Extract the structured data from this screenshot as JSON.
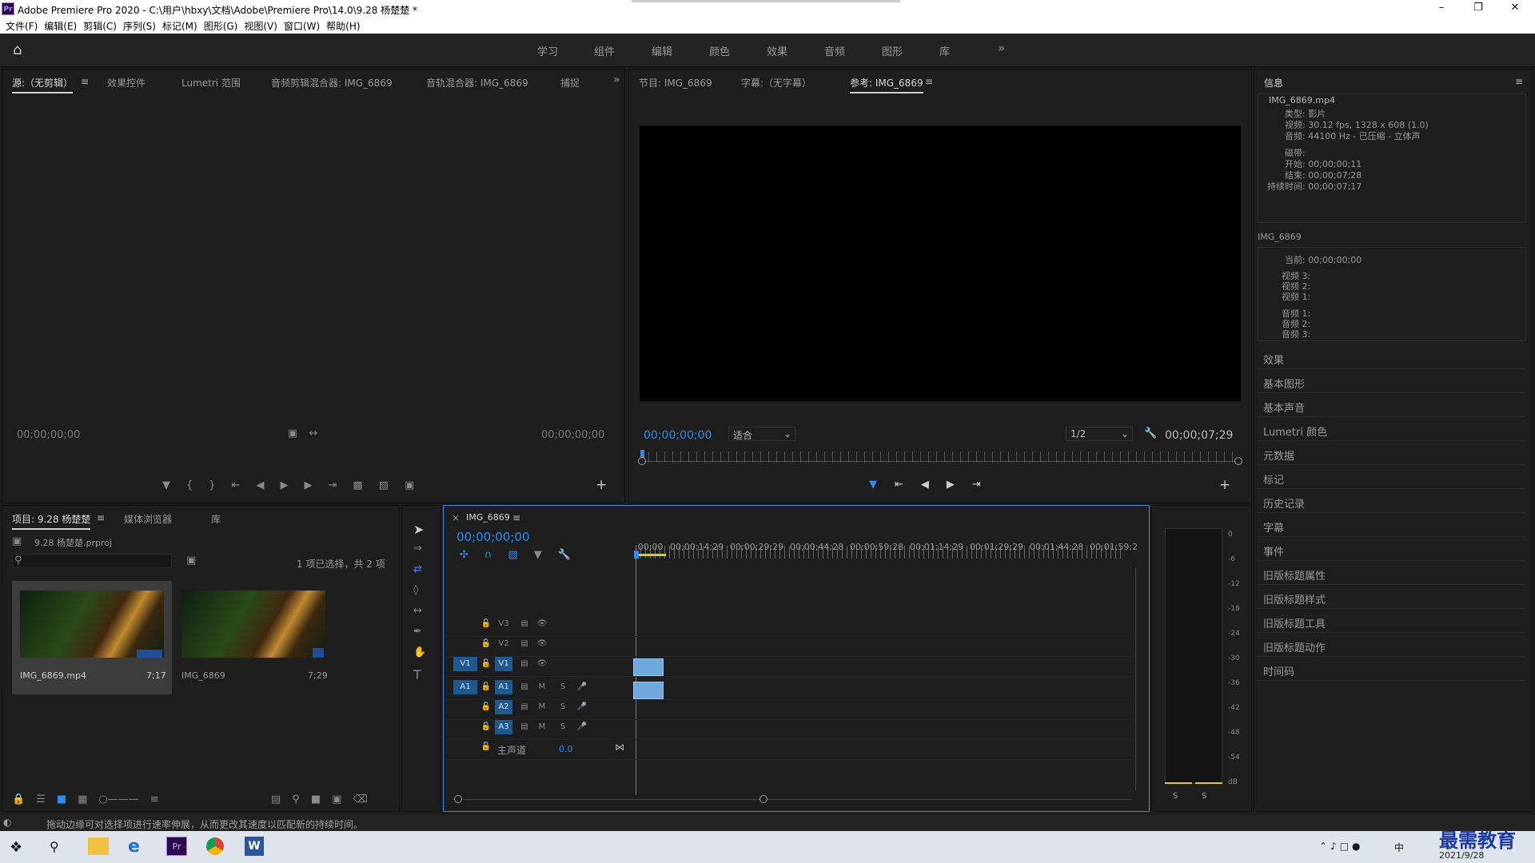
{
  "titlebar": {
    "app_icon": "Pr",
    "title": "Adobe Premiere Pro 2020 - C:\\用户\\hbxy\\文档\\Adobe\\Premiere Pro\\14.0\\9.28 杨楚楚 *"
  },
  "menu": [
    "文件(F)",
    "编辑(E)",
    "剪辑(C)",
    "序列(S)",
    "标记(M)",
    "图形(G)",
    "视图(V)",
    "窗口(W)",
    "帮助(H)"
  ],
  "workspaces": [
    "学习",
    "组件",
    "编辑",
    "颜色",
    "效果",
    "音频",
    "图形",
    "库"
  ],
  "source_panel": {
    "tabs": [
      "源:（无剪辑）",
      "效果控件",
      "Lumetri 范围",
      "音频剪辑混合器: IMG_6869",
      "音轨混合器: IMG_6869",
      "捕捉"
    ],
    "tc_left": "00;00;00;00",
    "tc_right": "00;00;00;00"
  },
  "program_panel": {
    "tabs": [
      "节目: IMG_6869",
      "字幕:（无字幕）",
      "参考: IMG_6869"
    ],
    "tc_current": "00;00;00;00",
    "fit": "适合",
    "resolution": "1/2",
    "tc_duration": "00;00;07;29"
  },
  "info_panel": {
    "title": "信息",
    "clip_name": "IMG_6869.mp4",
    "lines": [
      "类型: 影片",
      "视频: 30.12 fps, 1328 x 608 (1.0)",
      "音频: 44100 Hz - 已压缩 - 立体声",
      "磁带:",
      "开始: 00;00;00;11",
      "结束: 00;00;07;28",
      "持续时间: 00;00;07;17"
    ],
    "seq_name": "IMG_6869",
    "seq_lines": [
      "当前: 00;00;00;00",
      "视频 3:",
      "视频 2:",
      "视频 1:",
      "音频 1:",
      "音频 2:",
      "音频 3:"
    ]
  },
  "right_list": [
    "效果",
    "基本图形",
    "基本声音",
    "Lumetri 颜色",
    "元数据",
    "标记",
    "历史记录",
    "字幕",
    "事件",
    "旧版标题属性",
    "旧版标题样式",
    "旧版标题工具",
    "旧版标题动作",
    "时间码"
  ],
  "project_panel": {
    "tabs": [
      "项目: 9.28 杨楚楚",
      "媒体浏览器",
      "库"
    ],
    "file": "9.28 杨楚楚.prproj",
    "selection": "1 项已选择，共 2 项",
    "items": [
      {
        "name": "IMG_6869.mp4",
        "dur": "7;17"
      },
      {
        "name": "IMG_6869",
        "dur": "7;29"
      }
    ]
  },
  "timeline": {
    "tab": "IMG_6869",
    "tc": "00;00;00;00",
    "ruler": [
      ":00;00",
      "00;00;14;29",
      "00;00;29;29",
      "00;00;44;28",
      "00;00;59;28",
      "00;01;14;29",
      "00;01;29;29",
      "00;01;44;28",
      "00;01;59;2"
    ],
    "video_tracks": [
      "V3",
      "V2",
      "V1"
    ],
    "audio_tracks": [
      "A1",
      "A2",
      "A3"
    ],
    "src_v": "V1",
    "src_a": "A1",
    "master": "主声道",
    "master_val": "0.0",
    "mute": "M",
    "solo": "S"
  },
  "meter": {
    "labels": [
      "0",
      "-6",
      "-12",
      "-18",
      "-24",
      "-30",
      "-36",
      "-42",
      "-48",
      "-54",
      "dB"
    ],
    "solo": "S"
  },
  "status": "拖动边缘可对选择项进行速率伸展，从而更改其速度以匹配新的持续时间。",
  "taskbar": {
    "date": "2021/9/28",
    "brand": "最需教育",
    "ime": "中"
  }
}
